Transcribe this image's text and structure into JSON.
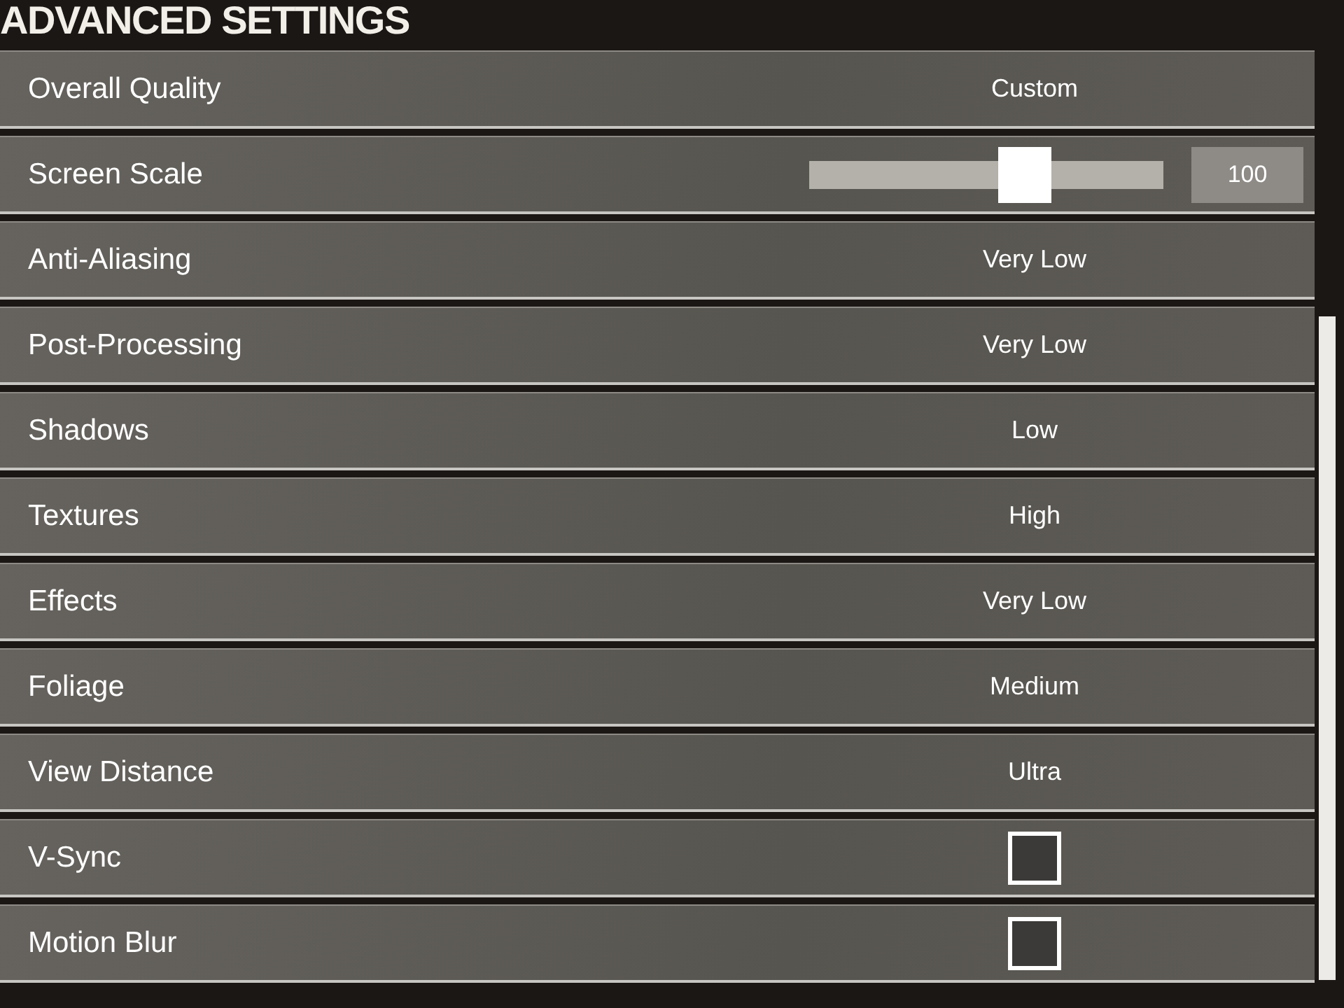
{
  "title": "ADVANCED SETTINGS",
  "settings": [
    {
      "kind": "select",
      "label": "Overall Quality",
      "value": "Custom"
    },
    {
      "kind": "slider",
      "label": "Screen Scale",
      "level": 0.63,
      "reading": "100"
    },
    {
      "kind": "select",
      "label": "Anti-Aliasing",
      "value": "Very Low"
    },
    {
      "kind": "select",
      "label": "Post-Processing",
      "value": "Very Low"
    },
    {
      "kind": "select",
      "label": "Shadows",
      "value": "Low"
    },
    {
      "kind": "select",
      "label": "Textures",
      "value": "High"
    },
    {
      "kind": "select",
      "label": "Effects",
      "value": "Very Low"
    },
    {
      "kind": "select",
      "label": "Foliage",
      "value": "Medium"
    },
    {
      "kind": "select",
      "label": "View Distance",
      "value": "Ultra"
    },
    {
      "kind": "checkbox",
      "label": "V-Sync",
      "checked": false
    },
    {
      "kind": "checkbox",
      "label": "Motion Blur",
      "checked": false
    }
  ]
}
